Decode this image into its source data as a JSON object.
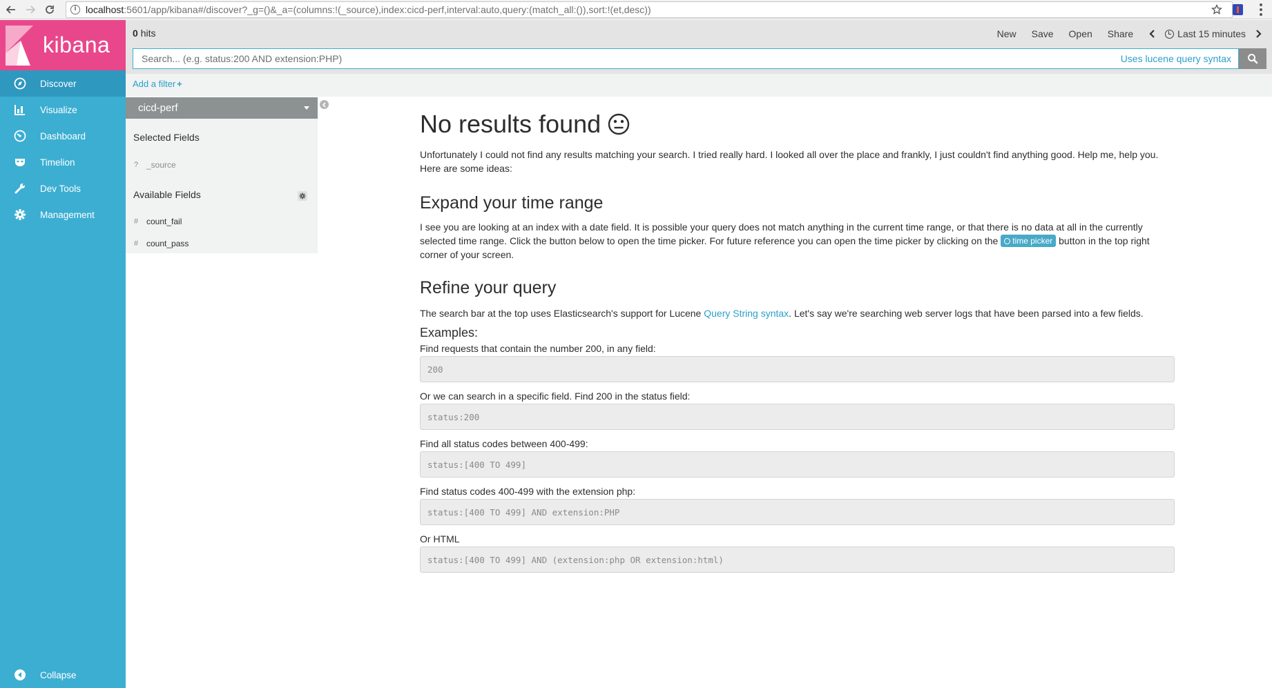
{
  "browser": {
    "url_host": "localhost",
    "url_rest": ":5601/app/kibana#/discover?_g=()&_a=(columns:!(_source),index:cicd-perf,interval:auto,query:(match_all:()),sort:!(et,desc))"
  },
  "sidebar": {
    "logo_text": "kibana",
    "items": [
      {
        "label": "Discover",
        "icon": "compass-icon",
        "active": true
      },
      {
        "label": "Visualize",
        "icon": "bar-chart-icon",
        "active": false
      },
      {
        "label": "Dashboard",
        "icon": "gauge-icon",
        "active": false
      },
      {
        "label": "Timelion",
        "icon": "timelion-mask-icon",
        "active": false
      },
      {
        "label": "Dev Tools",
        "icon": "wrench-icon",
        "active": false
      },
      {
        "label": "Management",
        "icon": "gear-icon",
        "active": false
      }
    ],
    "collapse_label": "Collapse"
  },
  "topbar": {
    "hits_count": "0",
    "hits_label": "hits",
    "new": "New",
    "save": "Save",
    "open": "Open",
    "share": "Share",
    "time_range": "Last 15 minutes"
  },
  "search": {
    "placeholder": "Search... (e.g. status:200 AND extension:PHP)",
    "lucene_link": "Uses lucene query syntax"
  },
  "filter": {
    "add_label": "Add a filter",
    "add_plus": "+"
  },
  "fields": {
    "index_pattern": "cicd-perf",
    "selected_title": "Selected Fields",
    "selected": [
      {
        "type": "?",
        "name": "_source"
      }
    ],
    "available_title": "Available Fields",
    "available": [
      {
        "type": "#",
        "name": "count_fail"
      },
      {
        "type": "#",
        "name": "count_pass"
      }
    ]
  },
  "main": {
    "title": "No results found",
    "intro": "Unfortunately I could not find any results matching your search. I tried really hard. I looked all over the place and frankly, I just couldn't find anything good. Help me, help you. Here are some ideas:",
    "expand_title": "Expand your time range",
    "expand_text_1": "I see you are looking at an index with a date field. It is possible your query does not match anything in the current time range, or that there is no data at all in the currently selected time range. Click the button below to open the time picker. For future reference you can open the time picker by clicking on the",
    "time_picker_label": "time picker",
    "expand_text_2": "button in the top right corner of your screen.",
    "refine_title": "Refine your query",
    "refine_text_1": "The search bar at the top uses Elasticsearch's support for Lucene",
    "refine_link": "Query String syntax",
    "refine_text_2": ". Let's say we're searching web server logs that have been parsed into a few fields.",
    "examples_title": "Examples:",
    "examples": [
      {
        "label": "Find requests that contain the number 200, in any field:",
        "code": "200"
      },
      {
        "label": "Or we can search in a specific field. Find 200 in the status field:",
        "code": "status:200"
      },
      {
        "label": "Find all status codes between 400-499:",
        "code": "status:[400 TO 499]"
      },
      {
        "label": "Find status codes 400-499 with the extension php:",
        "code": "status:[400 TO 499] AND extension:PHP"
      },
      {
        "label": "Or HTML",
        "code": "status:[400 TO 499] AND (extension:php OR extension:html)"
      }
    ]
  },
  "colors": {
    "sidebar": "#3caed2",
    "logo_bg": "#e8488b",
    "active_nav": "#2e98bf",
    "link": "#2a9fc9"
  }
}
